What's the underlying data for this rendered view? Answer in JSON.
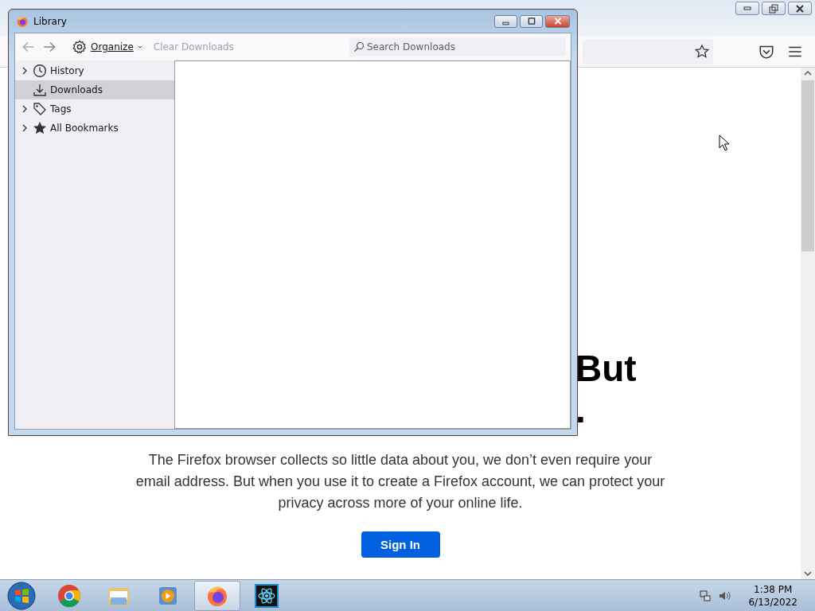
{
  "library": {
    "title": "Library",
    "toolbar": {
      "organize": "Organize",
      "clear_downloads": {
        "label": "Clear Downloads",
        "disabled": true
      },
      "search": {
        "placeholder": "Search Downloads"
      }
    },
    "sidebar": {
      "items": [
        {
          "label": "History",
          "kind": "history",
          "expandable": true,
          "selected": false
        },
        {
          "label": "Downloads",
          "kind": "downloads",
          "expandable": false,
          "selected": true
        },
        {
          "label": "Tags",
          "kind": "tags",
          "expandable": true,
          "selected": false
        },
        {
          "label": "All Bookmarks",
          "kind": "bookmarks",
          "expandable": true,
          "selected": false
        }
      ]
    }
  },
  "page": {
    "heading": [
      "But",
      "."
    ],
    "paragraph": "The Firefox browser collects so little data about you, we don’t even require your email address. But when you use it to create a Firefox account, we can protect your privacy across more of your online life.",
    "sign_in": "Sign In"
  },
  "taskbar": {
    "apps": [
      {
        "kind": "chrome",
        "active": false
      },
      {
        "kind": "explorer",
        "active": false
      },
      {
        "kind": "media",
        "active": false
      },
      {
        "kind": "firefox",
        "active": true
      },
      {
        "kind": "atom",
        "active": false
      }
    ],
    "clock": {
      "time": "1:38 PM",
      "date": "6/13/2022"
    }
  }
}
